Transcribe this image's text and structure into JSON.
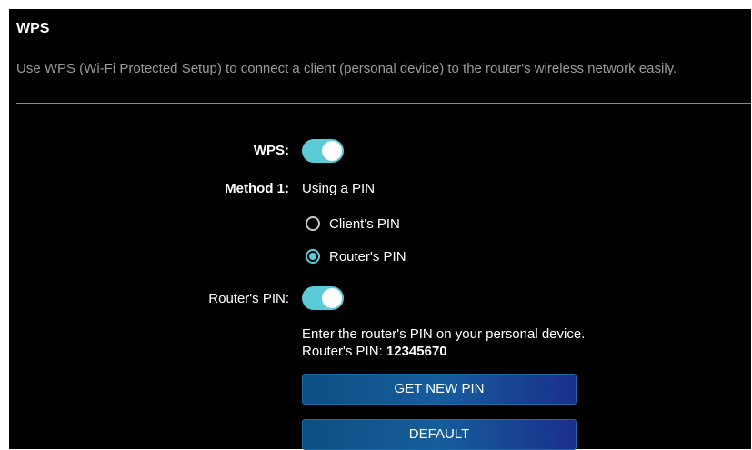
{
  "wps": {
    "title": "WPS",
    "description": "Use WPS (Wi-Fi Protected Setup) to connect a client (personal device) to the router's wireless network easily.",
    "wps_label": "WPS:",
    "wps_enabled": true,
    "method_label": "Method 1:",
    "method_value": "Using a PIN",
    "options": [
      {
        "label": "Client's PIN",
        "selected": false
      },
      {
        "label": "Router's PIN",
        "selected": true
      }
    ],
    "router_pin_label": "Router's PIN:",
    "router_pin_enabled": true,
    "instruction": "Enter the router's PIN on your personal device.",
    "pin_prefix": "Router's PIN: ",
    "pin_value": "12345670",
    "get_new_pin_button": "GET NEW PIN",
    "default_button": "DEFAULT"
  },
  "colors": {
    "accent": "#5ccbd8",
    "button_blue": "#165d9c",
    "background": "#000000",
    "description_text": "#9a9a9a"
  }
}
